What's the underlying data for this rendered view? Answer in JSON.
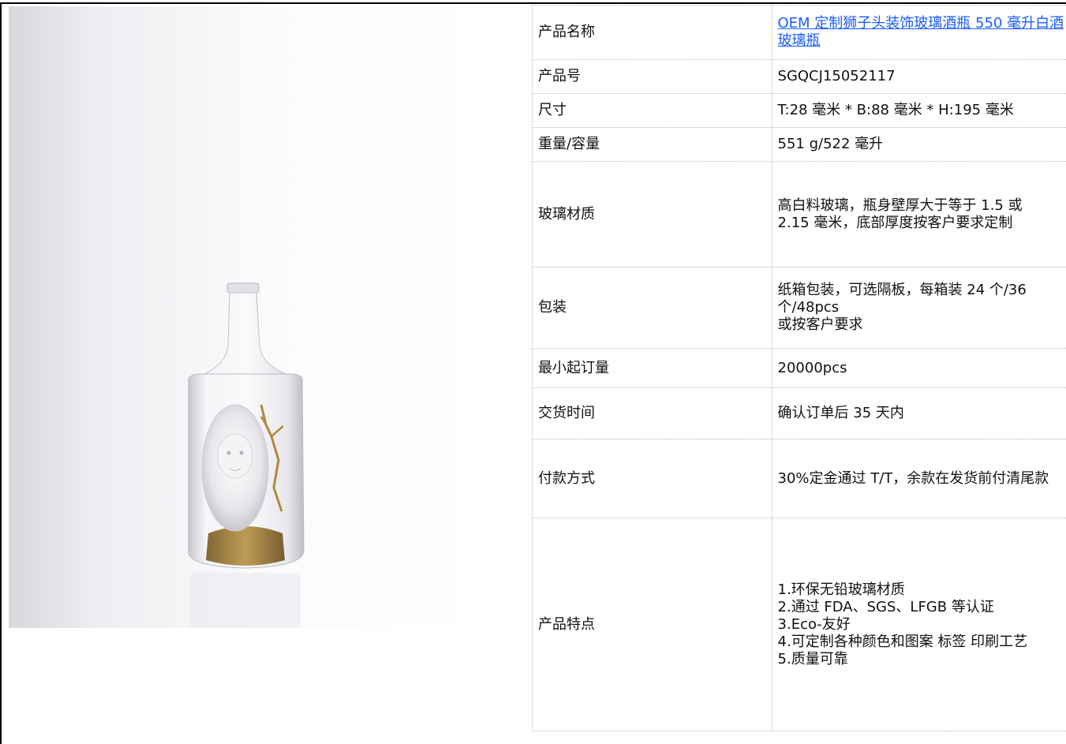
{
  "product": {
    "image_alt": "Clear glass bottle with frosted lion head relief and gold accents",
    "colors": {
      "link": "#1a5cff",
      "gold": "#b08a3a",
      "frame": "#000000"
    }
  },
  "specs": [
    {
      "label": "产品名称",
      "value": [
        "OEM 定制狮子头装饰玻璃酒瓶 550 毫升白酒玻璃瓶"
      ],
      "is_link": true
    },
    {
      "label": "产品号",
      "value": [
        "SGQCJ15052117"
      ]
    },
    {
      "label": "尺寸",
      "value": [
        "T:28 毫米 * B:88 毫米 * H:195 毫米"
      ]
    },
    {
      "label": "重量/容量",
      "value": [
        "551 g/522 毫升"
      ]
    },
    {
      "label": "玻璃材质",
      "value": [
        "高白料玻璃，瓶身壁厚大于等于 1.5 或",
        "2.15 毫米，底部厚度按客户要求定制"
      ]
    },
    {
      "label": "包装",
      "value": [
        "纸箱包装，可选隔板，每箱装 24 个/36 个/48pcs",
        "或按客户要求"
      ]
    },
    {
      "label": "最小起订量",
      "value": [
        "20000pcs"
      ]
    },
    {
      "label": "交货时间",
      "value": [
        "确认订单后 35 天内"
      ]
    },
    {
      "label": "付款方式",
      "value": [
        "30%定金通过 T/T，余款在发货前付清尾款"
      ]
    },
    {
      "label": "产品特点",
      "value": [
        "1.环保无铅玻璃材质",
        "2.通过 FDA、SGS、LFGB 等认证",
        "3.Eco-友好",
        "4.可定制各种颜色和图案 标签 印刷工艺",
        "5.质量可靠"
      ]
    }
  ]
}
